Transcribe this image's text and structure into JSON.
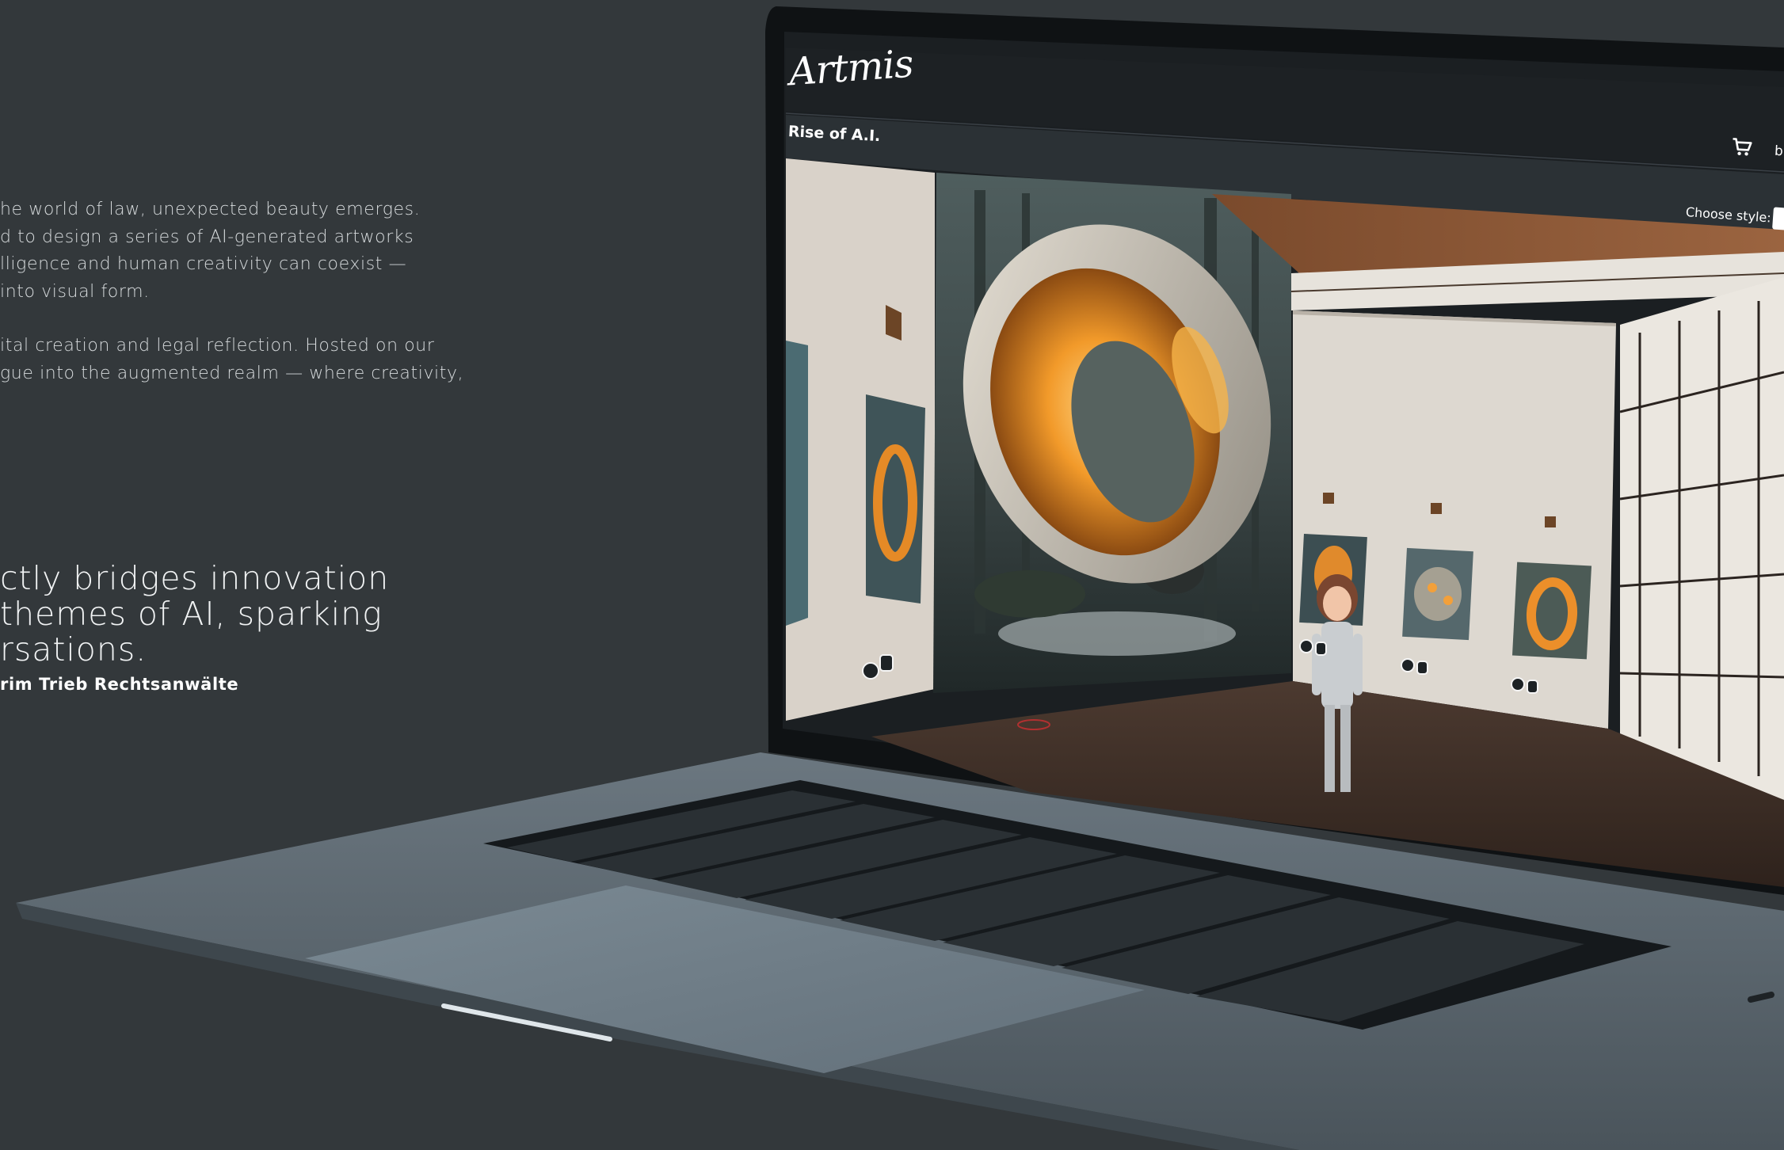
{
  "intro": {
    "paragraph1": [
      "he world of law, unexpected beauty emerges.",
      "d to design a series of AI-generated artworks",
      "lligence and human creativity can coexist —",
      "into visual form."
    ],
    "paragraph2": [
      "ital creation and legal reflection. Hosted on our",
      "gue into the augmented realm — where creativity,"
    ]
  },
  "quote": {
    "lines": [
      "ctly bridges innovation",
      "themes of AI, sparking",
      "rsations."
    ],
    "attribution": "rim Trieb Rechtsanwälte"
  },
  "screen": {
    "logo": "Artmis",
    "gallery_title": "Rise of A.I.",
    "cart_icon": "cart-icon",
    "header_right_cut": "b",
    "style_label": "Choose style:"
  },
  "colors": {
    "background": "#33383b",
    "laptop_body": "#5a656e",
    "screen_bar": "#1b1f22",
    "glow": "#f5a030"
  }
}
